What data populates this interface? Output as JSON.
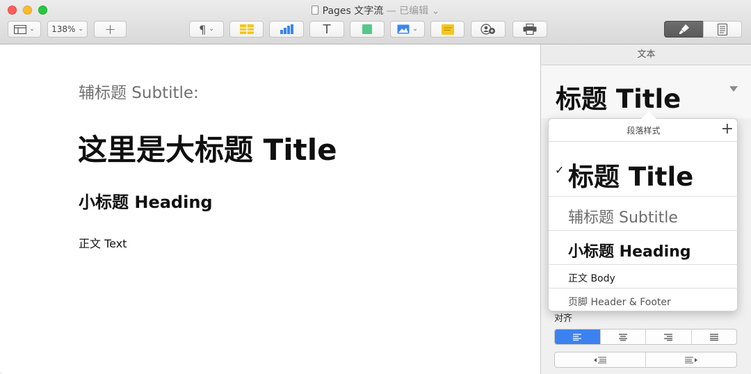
{
  "window": {
    "title": "Pages 文字流",
    "status": " — 已编辑",
    "status_chevron": "⌄"
  },
  "toolbar": {
    "zoom": "138%",
    "add_symbol": "+",
    "paragraph_symbol": "¶",
    "text_symbol": "T",
    "accent_color": "#3b82f0",
    "icons": [
      "view-icon",
      "paragraph-icon",
      "table-icon",
      "chart-icon",
      "text-icon",
      "shape-icon",
      "media-icon",
      "comment-icon",
      "collaborate-icon",
      "print-icon",
      "format-brush-icon",
      "document-icon"
    ]
  },
  "document": {
    "subtitle": "辅标题 Subtitle:",
    "title": "这里是大标题 Title",
    "heading": "小标题 Heading",
    "body": "正文 Text"
  },
  "inspector": {
    "tab": "文本",
    "current_style": "标题 Title",
    "alignment_label": "对齐"
  },
  "paragraph_styles": {
    "header": "段落样式",
    "add": "+",
    "check": "✓",
    "items": [
      {
        "label": "标题 Title",
        "selected": true
      },
      {
        "label": "辅标题 Subtitle",
        "selected": false
      },
      {
        "label": "小标题 Heading",
        "selected": false
      },
      {
        "label": "正文 Body",
        "selected": false
      },
      {
        "label": "页脚 Header & Footer",
        "selected": false
      }
    ]
  }
}
